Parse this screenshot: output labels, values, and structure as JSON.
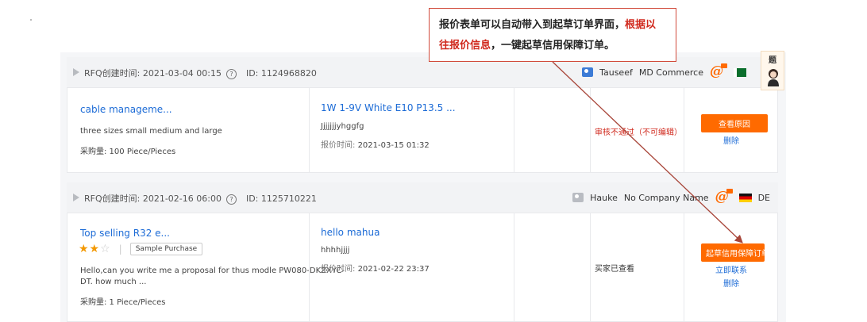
{
  "callout": {
    "part1": "报价表单可以自动带入到起草订单界面，",
    "red": "根据以往报价信息",
    "part2": "，一键起草信用保障订单。"
  },
  "widget": {
    "label": "题"
  },
  "rfqs": [
    {
      "created": "RFQ创建时间: 2021-03-04 00:15",
      "id": "ID: 1124968820",
      "buyer": "Tauseef",
      "company": "MD Commerce",
      "country": "",
      "product_title": "cable manageme...",
      "product_desc": "three sizes small medium and large",
      "quantity": "采购量: 100 Piece/Pieces",
      "quote_title": "1W 1-9V White E10 P13.5 ...",
      "quote_desc": "Jjjjjjjyhggfg",
      "quote_time_label": "报价时间:",
      "quote_time": "2021-03-15 01:32",
      "status": "审核不通过（不可编辑）",
      "action_button": "查看原因",
      "links": [
        "删除"
      ]
    },
    {
      "created": "RFQ创建时间: 2021-02-16 06:00",
      "id": "ID: 1125710221",
      "buyer": "Hauke",
      "company": "No Company Name",
      "country": "DE",
      "product_title": "Top selling R32 e...",
      "rating": "2 of 5",
      "sample_tag": "Sample Purchase",
      "product_desc_lines": [
        "Hello,can you write me a proposal for thus modle PW080-DKZXYC-",
        "DT. how much ..."
      ],
      "quantity": "采购量: 1 Piece/Pieces",
      "quote_title": "hello mahua",
      "quote_desc": "hhhhjjjj",
      "quote_time_label": "报价时间:",
      "quote_time": "2021-02-22 23:37",
      "status": "买家已查看",
      "action_button": "起草信用保障订单",
      "links": [
        "立即联系",
        "删除"
      ]
    }
  ],
  "colors": {
    "accent": "#ff6a00",
    "link": "#1c6bd6",
    "annotation": "#d0281c",
    "arrow": "#a8463a"
  }
}
